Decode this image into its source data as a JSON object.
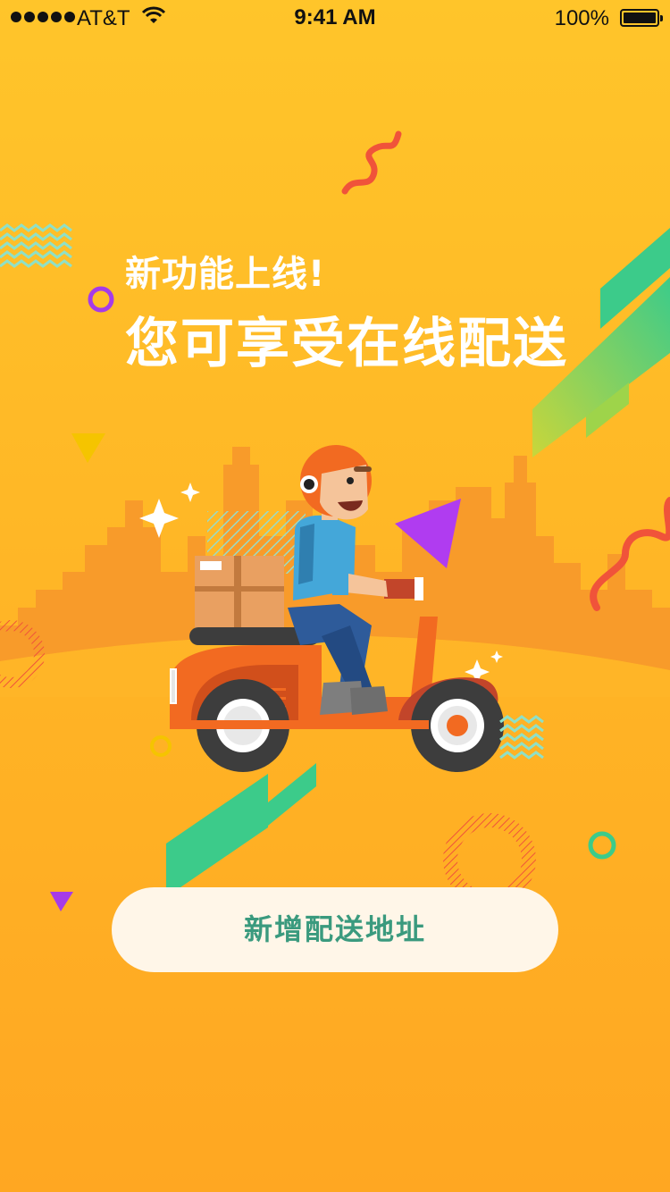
{
  "status_bar": {
    "carrier": "AT&T",
    "time": "9:41 AM",
    "battery_percent": "100%",
    "battery_level": 1.0,
    "signal_bars": 5,
    "icons": [
      "signal-dots-icon",
      "wifi-icon",
      "battery-icon"
    ]
  },
  "promo": {
    "headline_small": "新功能上线!",
    "headline_large": "您可享受在线配送"
  },
  "cta": {
    "label": "新增配送地址"
  },
  "colors": {
    "background_top": "#FFC52A",
    "background_bottom": "#FFA722",
    "accent_green": "#3A9A7E",
    "button_bg": "#FFF6E8",
    "scooter_orange": "#F26A21",
    "helmet_orange": "#F26A21",
    "purple": "#A63BE8",
    "skyline": "#F89B2A"
  },
  "illustration": {
    "subject": "delivery-courier-on-scooter-icon",
    "decorations": [
      "zigzag-icon",
      "ring-icon",
      "triangle-icon",
      "sparkle-icon",
      "diagonal-stripe-icon",
      "city-skyline-icon",
      "squiggle-icon"
    ]
  }
}
